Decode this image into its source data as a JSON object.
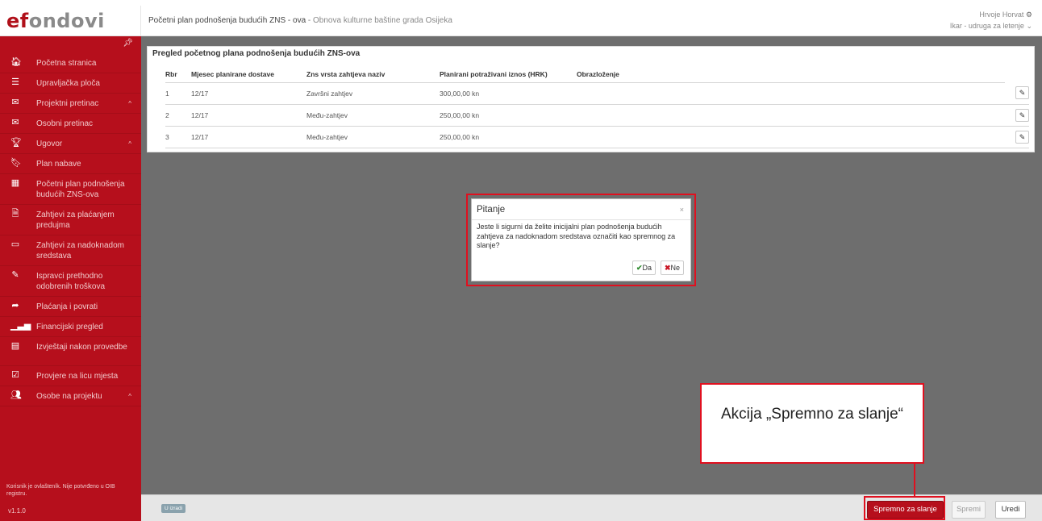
{
  "header": {
    "logo_prefix": "ef",
    "logo_rest": "ondovi",
    "page_title": "Početni plan podnošenja budućih ZNS - ova",
    "separator": " - ",
    "project_name": "Obnova kulturne baštine grada Osijeka",
    "user_name": "Hrvoje Horvat",
    "user_org": "Ikar - udruga za letenje"
  },
  "sidebar": {
    "pin_icon": "pin-icon",
    "items": [
      {
        "label": "Početna stranica",
        "icon": "home-icon",
        "glyph": "🏠︎",
        "caret": false
      },
      {
        "label": "Upravljačka ploča",
        "icon": "list-icon",
        "glyph": "☰",
        "caret": false
      },
      {
        "label": "Projektni pretinac",
        "icon": "envelope-icon",
        "glyph": "✉",
        "caret": true
      },
      {
        "label": "Osobni pretinac",
        "icon": "envelope-icon",
        "glyph": "✉",
        "caret": false
      },
      {
        "label": "Ugovor",
        "icon": "trophy-icon",
        "glyph": "🏆︎",
        "caret": true
      },
      {
        "label": "Plan nabave",
        "icon": "bookmark-icon",
        "glyph": "🔖︎",
        "caret": false
      },
      {
        "label": "Početni plan podnošenja budućih ZNS-ova",
        "icon": "calendar-icon",
        "glyph": "▦",
        "caret": false
      },
      {
        "label": "Zahtjevi za plaćanjem predujma",
        "icon": "document-icon",
        "glyph": "🗎︎",
        "caret": false
      },
      {
        "label": "Zahtjevi za nadoknadom sredstava",
        "icon": "card-icon",
        "glyph": "▭",
        "caret": false
      },
      {
        "label": "Ispravci prethodno odobrenih troškova",
        "icon": "edit-icon",
        "glyph": "✎",
        "caret": false
      },
      {
        "label": "Plaćanja i povrati",
        "icon": "share-icon",
        "glyph": "➦",
        "caret": false
      },
      {
        "label": "Financijski pregled",
        "icon": "chart-icon",
        "glyph": "▁▃▅",
        "caret": false
      },
      {
        "label": "Izvještaji nakon provedbe",
        "icon": "report-icon",
        "glyph": "▤",
        "caret": false
      },
      {
        "label": "Provjere na licu mjesta",
        "icon": "checkbox-icon",
        "glyph": "☑",
        "caret": false
      },
      {
        "label": "Osobe na projektu",
        "icon": "users-icon",
        "glyph": "👥︎",
        "caret": true
      }
    ],
    "caret_glyph": "^",
    "note": "Korisnik je ovlašteník. Nije potvrđeno u OIB registru.",
    "version": "v1.1.0"
  },
  "panel": {
    "title": "Pregled početnog plana podnošenja budućih ZNS-ova",
    "columns": [
      "Rbr",
      "Mjesec planirane dostave",
      "Zns vrsta zahtjeva naziv",
      "Planirani potraživani iznos (HRK)",
      "Obrazloženje"
    ],
    "rows": [
      {
        "rbr": "1",
        "month": "12/17",
        "type": "Završni zahtjev",
        "amount": "300,00,00 kn",
        "note": ""
      },
      {
        "rbr": "2",
        "month": "12/17",
        "type": "Među-zahtjev",
        "amount": "250,00,00 kn",
        "note": ""
      },
      {
        "rbr": "3",
        "month": "12/17",
        "type": "Među-zahtjev",
        "amount": "250,00,00 kn",
        "note": ""
      }
    ],
    "edit_glyph": "✎"
  },
  "dialog": {
    "title": "Pitanje",
    "close": "×",
    "message": "Jeste li sigurni da želite inicijalni plan podnošenja budućih zahtjeva za nadoknadom sredstava označiti kao spremnog za slanje?",
    "yes_mark": "✔",
    "yes_label": "Da",
    "no_mark": "✖",
    "no_label": "Ne"
  },
  "footer": {
    "status_badge": "U izradi",
    "ready_button": "Spremno za slanje",
    "send_button": "Spremi",
    "edit_button": "Uredi"
  },
  "callout": {
    "text": "Akcija „Spremno za slanje“"
  },
  "colors": {
    "brand_red": "#b60f1c",
    "highlight_red": "#e0101f",
    "overlay_gray": "#6e6e6e"
  }
}
